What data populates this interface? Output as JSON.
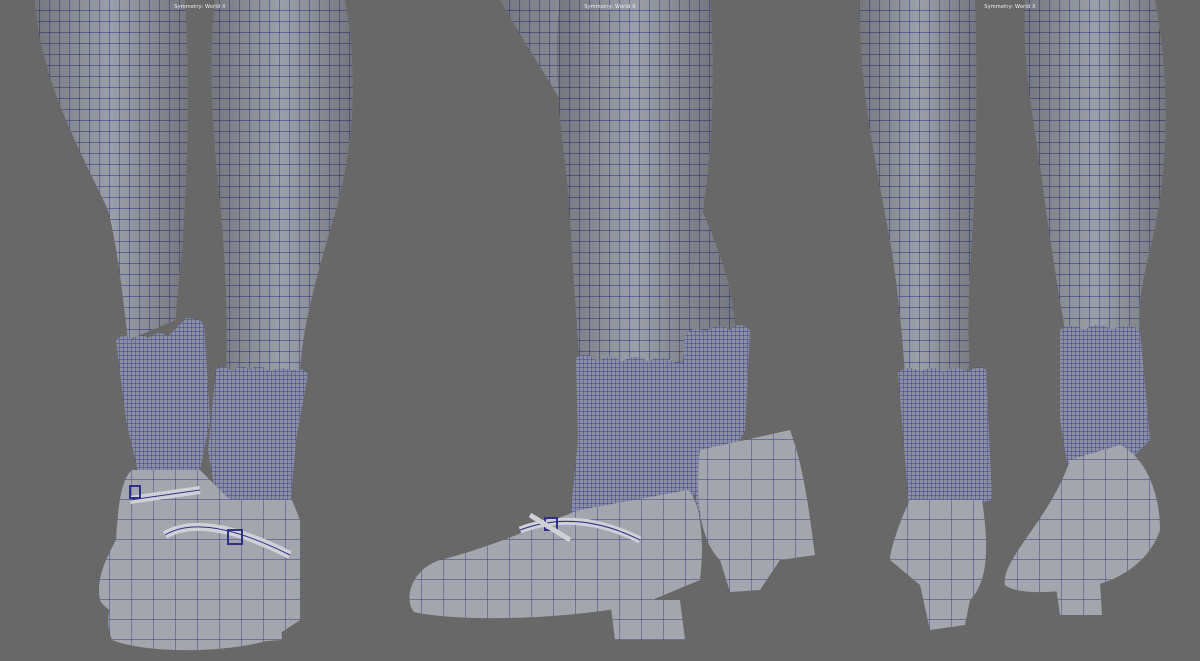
{
  "viewports": [
    {
      "label": "Symmetry: World X"
    },
    {
      "label": "Symmetry: World X"
    },
    {
      "label": "Symmetry: World X"
    }
  ],
  "colors": {
    "background": "#686868",
    "mesh_fill": "#9a9ea6",
    "mesh_shadow": "#7f838b",
    "wireframe": "#2a2a8a"
  }
}
